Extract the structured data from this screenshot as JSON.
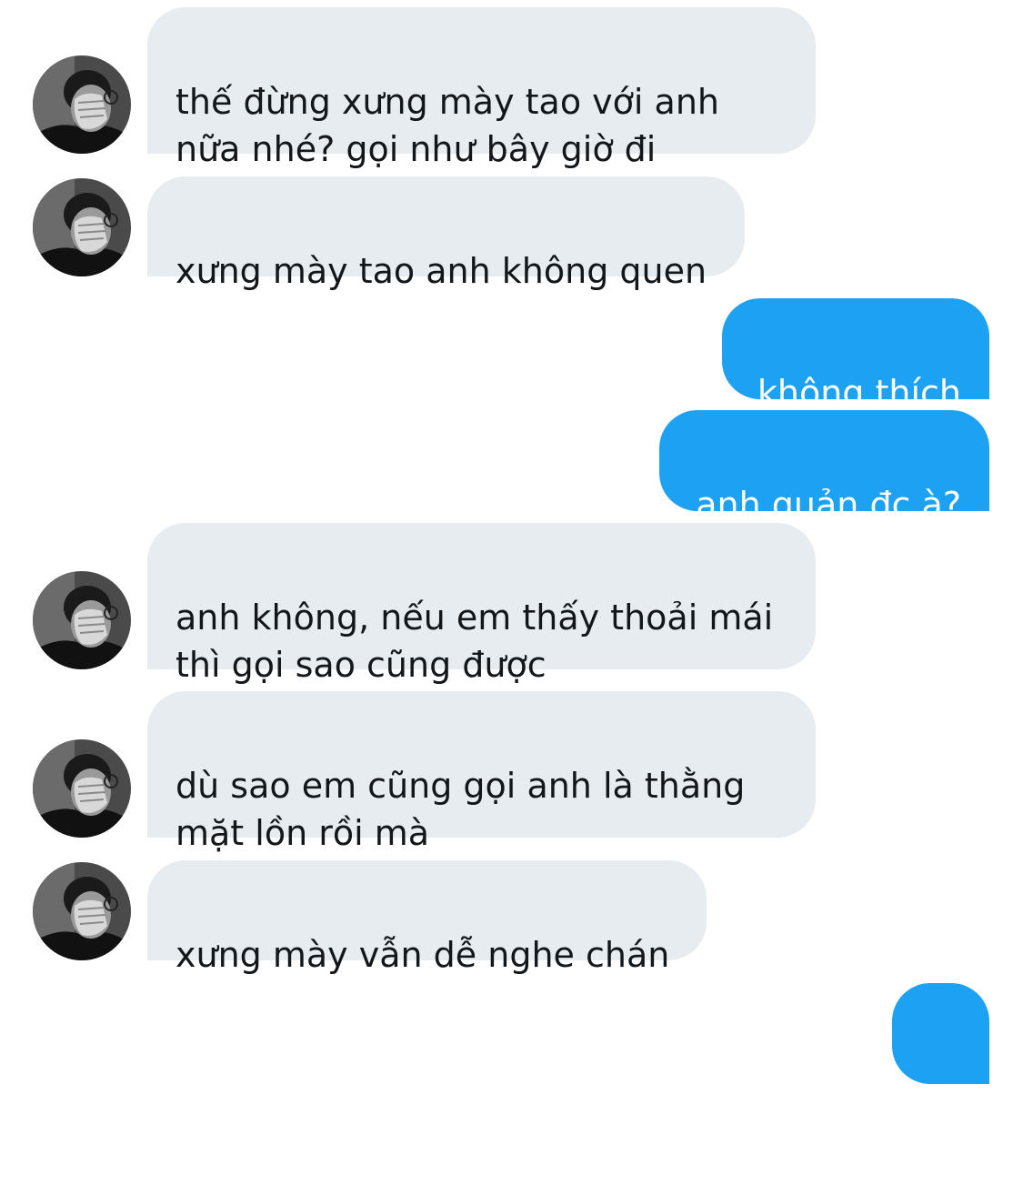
{
  "messages": [
    {
      "side": "received",
      "text": "thế đừng xưng mày tao với anh\nnữa nhé? gọi như bây giờ đi",
      "avatar": "contact-avatar"
    },
    {
      "side": "received",
      "text": "xưng mày tao anh không quen",
      "avatar": "contact-avatar"
    },
    {
      "side": "sent",
      "text": "không thích"
    },
    {
      "side": "sent",
      "text": "anh quản đc à?"
    },
    {
      "side": "received",
      "text": "anh không, nếu em thấy thoải mái\nthì gọi sao cũng được",
      "avatar": "contact-avatar"
    },
    {
      "side": "received",
      "text": "dù sao em cũng gọi anh là thằng\nmặt lồn rồi mà",
      "avatar": "contact-avatar"
    },
    {
      "side": "received",
      "text": "xưng mày vẫn dễ nghe chán",
      "avatar": "contact-avatar"
    },
    {
      "side": "sent",
      "text": "...."
    }
  ],
  "colors": {
    "received_bubble": "#e6ecf0",
    "received_text": "#14171a",
    "sent_bubble": "#1da1f2",
    "sent_text": "#ffffff"
  }
}
